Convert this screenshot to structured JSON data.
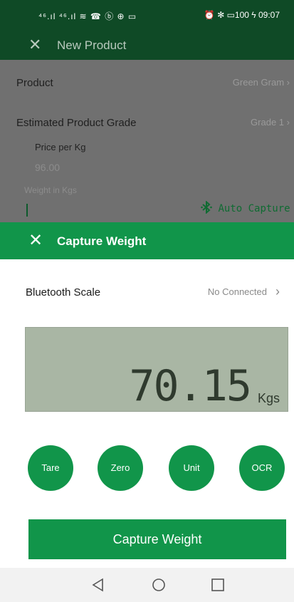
{
  "status_bar": {
    "left": "⁴⁶.ıl ⁴⁶.ıl ≋ ☎ ⓑ ⊕ ▭",
    "right": "⏰ ✻ ▭100 ϟ 09:07"
  },
  "background_screen": {
    "title": "New Product",
    "product_label": "Product",
    "product_value": "Green Gram",
    "grade_label": "Estimated Product Grade",
    "grade_value": "Grade 1",
    "price_label": "Price per Kg",
    "price_value": "96.00",
    "weight_label": "Weight in Kgs",
    "auto_capture": "Auto Capture"
  },
  "capture_sheet": {
    "title": "Capture Weight",
    "bluetooth_label": "Bluetooth Scale",
    "bluetooth_status": "No Connected",
    "display_value": "70.15",
    "display_unit": "Kgs",
    "buttons": [
      "Tare",
      "Zero",
      "Unit",
      "OCR"
    ],
    "capture_button": "Capture Weight"
  },
  "colors": {
    "primary_green": "#11954a",
    "dark_green": "#0f4a26",
    "lcd_background": "#a9b6a4"
  },
  "icons": [
    "close-icon",
    "bluetooth-icon",
    "chevron-right-icon",
    "back-nav-icon",
    "home-nav-icon",
    "recents-nav-icon"
  ]
}
